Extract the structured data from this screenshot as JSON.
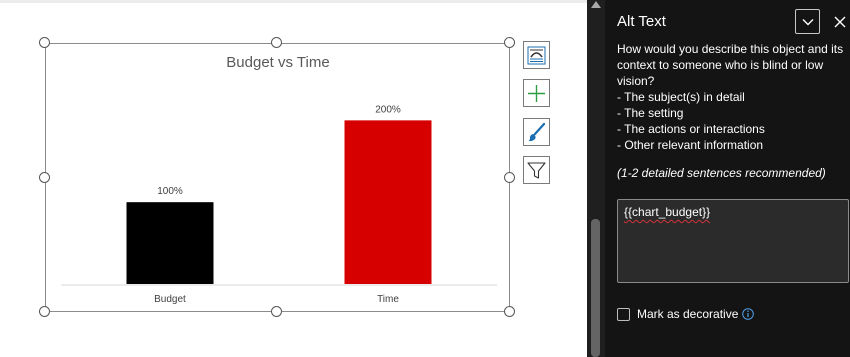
{
  "chart_data": {
    "type": "bar",
    "title": "Budget vs Time",
    "categories": [
      "Budget",
      "Time"
    ],
    "values": [
      1.0,
      2.0
    ],
    "data_labels": [
      "100%",
      "200%"
    ],
    "colors": [
      "#000000",
      "#d60000"
    ],
    "ylim": [
      0,
      2.2
    ],
    "grid": false,
    "legend": "none"
  },
  "chart_tools": {
    "styles_icon": "brush-icon",
    "elements_icon": "plus-icon",
    "layout_icon": "chart-layout-icon",
    "filter_icon": "filter-icon"
  },
  "alt_pane": {
    "title": "Alt Text",
    "description_lines": [
      "How would you describe this object and its",
      "context to someone who is blind or low",
      "vision?",
      "- The subject(s) in detail",
      "- The setting",
      "- The actions or interactions",
      "- Other relevant information"
    ],
    "hint": "(1-2 detailed sentences recommended)",
    "alt_text_value": "{{chart_budget}}",
    "decorative_label": "Mark as decorative",
    "colors": {
      "background": "#141414",
      "input_bg": "#2b2b2b",
      "info_blue": "#4f9de8"
    }
  }
}
